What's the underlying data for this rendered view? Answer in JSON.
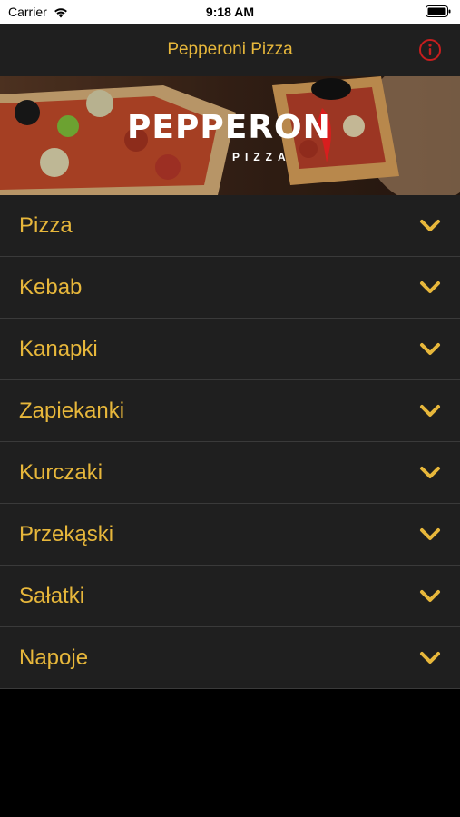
{
  "status_bar": {
    "carrier": "Carrier",
    "time": "9:18 AM"
  },
  "header": {
    "title": "Pepperoni Pizza",
    "info_icon": "info-icon"
  },
  "banner": {
    "logo_main": "PEPPERON",
    "logo_sub": "PIZZA"
  },
  "menu": {
    "items": [
      {
        "label": "Pizza"
      },
      {
        "label": "Kebab"
      },
      {
        "label": "Kanapki"
      },
      {
        "label": "Zapiekanki"
      },
      {
        "label": "Kurczaki"
      },
      {
        "label": "Przekąski"
      },
      {
        "label": "Sałatki"
      },
      {
        "label": "Napoje"
      }
    ]
  },
  "colors": {
    "accent": "#e7b73b",
    "row_bg": "#1f1f1f",
    "background": "#000000",
    "info_red": "#c81e1e"
  }
}
